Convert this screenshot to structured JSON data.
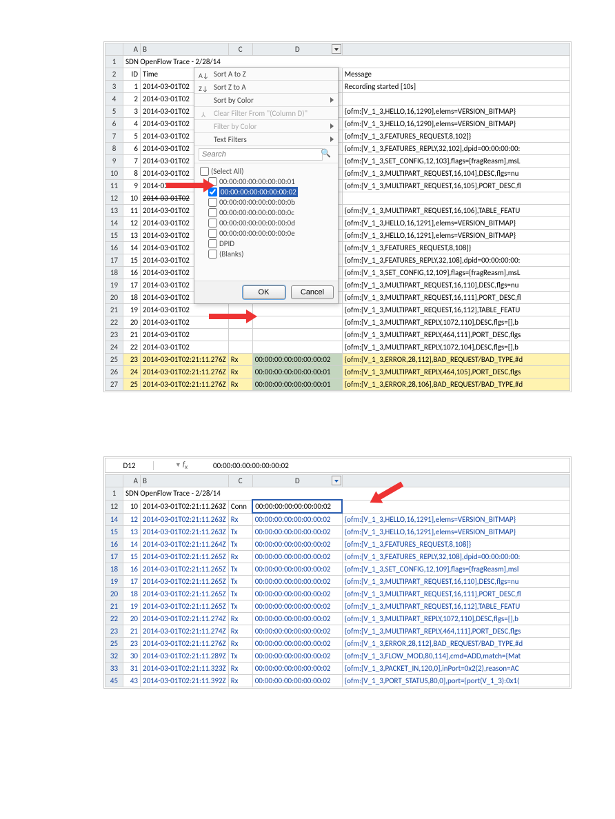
{
  "figure1": {
    "title": "SDN OpenFlow Trace - 2/28/14",
    "headers": {
      "A": "ID",
      "B": "Time",
      "E": "Message"
    },
    "menu": {
      "sort_az": "Sort A to Z",
      "sort_za": "Sort Z to A",
      "sort_color": "Sort by Color",
      "clear": "Clear Filter From \"(Column D)\"",
      "filter_color": "Filter by Color",
      "text_filters": "Text Filters",
      "search_ph": "Search",
      "select_all": "(Select All)",
      "items": [
        {
          "label": "00:00:00:00:00:00:00:01",
          "checked": false
        },
        {
          "label": "00:00:00:00:00:00:00:02",
          "checked": true,
          "highlight": true
        },
        {
          "label": "00:00:00:00:00:00:00:0b",
          "checked": false
        },
        {
          "label": "00:00:00:00:00:00:00:0c",
          "checked": false
        },
        {
          "label": "00:00:00:00:00:00:00:0d",
          "checked": false
        },
        {
          "label": "00:00:00:00:00:00:00:0e",
          "checked": false
        },
        {
          "label": "DPID",
          "checked": false
        },
        {
          "label": "(Blanks)",
          "checked": false
        }
      ],
      "ok": "OK",
      "cancel": "Cancel"
    },
    "rows": [
      {
        "n": 1,
        "title": true
      },
      {
        "n": 2,
        "A": "ID",
        "B": "Time",
        "E": "Message"
      },
      {
        "n": 3,
        "A": "1",
        "B": "2014-03-01T02",
        "E": "Recording started [10s]"
      },
      {
        "n": 4,
        "A": "2",
        "B": "2014-03-01T02"
      },
      {
        "n": 5,
        "A": "3",
        "B": "2014-03-01T02",
        "E": "{ofm:[V_1_3,HELLO,16,1290],elems=VERSION_BITMAP}"
      },
      {
        "n": 6,
        "A": "4",
        "B": "2014-03-01T02",
        "E": "{ofm:[V_1_3,HELLO,16,1290],elems=VERSION_BITMAP}"
      },
      {
        "n": 7,
        "A": "5",
        "B": "2014-03-01T02",
        "E": "{ofm:[V_1_3,FEATURES_REQUEST,8,102]}"
      },
      {
        "n": 8,
        "A": "6",
        "B": "2014-03-01T02",
        "E": "{ofm:[V_1_3,FEATURES_REPLY,32,102],dpid=00:00:00:00:"
      },
      {
        "n": 9,
        "A": "7",
        "B": "2014-03-01T02",
        "E": "{ofm:[V_1_3,SET_CONFIG,12,103],flags=[fragReasm],msL"
      },
      {
        "n": 10,
        "A": "8",
        "B": "2014-03-01T02",
        "E": "{ofm:[V_1_3,MULTIPART_REQUEST,16,104],DESC,flgs=nu"
      },
      {
        "n": 11,
        "A": "9",
        "B": "2014-03-01T02",
        "E": "{ofm:[V_1_3,MULTIPART_REQUEST,16,105],PORT_DESC,fl"
      },
      {
        "n": 12,
        "A": "10",
        "B": "2014-03-01T02",
        "sel": true
      },
      {
        "n": 13,
        "A": "11",
        "B": "2014-03-01T02",
        "E": "{ofm:[V_1_3,MULTIPART_REQUEST,16,106],TABLE_FEATU"
      },
      {
        "n": 14,
        "A": "12",
        "B": "2014-03-01T02",
        "E": "{ofm:[V_1_3,HELLO,16,1291],elems=VERSION_BITMAP}"
      },
      {
        "n": 15,
        "A": "13",
        "B": "2014-03-01T02",
        "E": "{ofm:[V_1_3,HELLO,16,1291],elems=VERSION_BITMAP}"
      },
      {
        "n": 16,
        "A": "14",
        "B": "2014-03-01T02",
        "E": "{ofm:[V_1_3,FEATURES_REQUEST,8,108]}"
      },
      {
        "n": 17,
        "A": "15",
        "B": "2014-03-01T02",
        "E": "{ofm:[V_1_3,FEATURES_REPLY,32,108],dpid=00:00:00:00:"
      },
      {
        "n": 18,
        "A": "16",
        "B": "2014-03-01T02",
        "E": "{ofm:[V_1_3,SET_CONFIG,12,109],flags=[fragReasm],msL"
      },
      {
        "n": 19,
        "A": "17",
        "B": "2014-03-01T02",
        "E": "{ofm:[V_1_3,MULTIPART_REQUEST,16,110],DESC,flgs=nu"
      },
      {
        "n": 20,
        "A": "18",
        "B": "2014-03-01T02",
        "E": "{ofm:[V_1_3,MULTIPART_REQUEST,16,111],PORT_DESC,fl"
      },
      {
        "n": 21,
        "A": "19",
        "B": "2014-03-01T02",
        "E": "{ofm:[V_1_3,MULTIPART_REQUEST,16,112],TABLE_FEATU"
      },
      {
        "n": 22,
        "A": "20",
        "B": "2014-03-01T02",
        "E": "{ofm:[V_1_3,MULTIPART_REPLY,1072,110],DESC,flgs=[],b"
      },
      {
        "n": 23,
        "A": "21",
        "B": "2014-03-01T02",
        "E": "{ofm:[V_1_3,MULTIPART_REPLY,464,111],PORT_DESC,flgs"
      },
      {
        "n": 24,
        "A": "22",
        "B": "2014-03-01T02",
        "E": "{ofm:[V_1_3,MULTIPART_REPLY,1072,104],DESC,flgs=[],b"
      },
      {
        "n": 25,
        "A": "23",
        "B": "2014-03-01T02:21:11.276Z",
        "C": "Rx",
        "D": "00:00:00:00:00:00:00:02",
        "E": "{ofm:[V_1_3,ERROR,28,112],BAD_REQUEST/BAD_TYPE,#d",
        "hl": true
      },
      {
        "n": 26,
        "A": "24",
        "B": "2014-03-01T02:21:11.276Z",
        "C": "Rx",
        "D": "00:00:00:00:00:00:00:01",
        "E": "{ofm:[V_1_3,MULTIPART_REPLY,464,105],PORT_DESC,flgs",
        "hl": true
      },
      {
        "n": 27,
        "A": "25",
        "B": "2014-03-01T02:21:11.276Z",
        "C": "Rx",
        "D": "00:00:00:00:00:00:00:01",
        "E": "{ofm:[V_1_3,ERROR,28,106],BAD_REQUEST/BAD_TYPE,#d",
        "hl": true
      }
    ]
  },
  "figure2": {
    "namebox": "D12",
    "formula_val": "00:00:00:00:00:00:00:02",
    "title": "SDN OpenFlow Trace - 2/28/14",
    "rows": [
      {
        "n": 1,
        "title": true
      },
      {
        "n": 12,
        "A": "10",
        "B": "2014-03-01T02:21:11.263Z",
        "C": "Conn",
        "D": "00:00:00:00:00:00:00:02",
        "selD": true
      },
      {
        "n": 14,
        "A": "12",
        "B": "2014-03-01T02:21:11.263Z",
        "C": "Rx",
        "D": "00:00:00:00:00:00:00:02",
        "E": "{ofm:[V_1_3,HELLO,16,1291],elems=VERSION_BITMAP}",
        "blue": true
      },
      {
        "n": 15,
        "A": "13",
        "B": "2014-03-01T02:21:11.263Z",
        "C": "Tx",
        "D": "00:00:00:00:00:00:00:02",
        "E": "{ofm:[V_1_3,HELLO,16,1291],elems=VERSION_BITMAP}",
        "blue": true
      },
      {
        "n": 16,
        "A": "14",
        "B": "2014-03-01T02:21:11.264Z",
        "C": "Tx",
        "D": "00:00:00:00:00:00:00:02",
        "E": "{ofm:[V_1_3,FEATURES_REQUEST,8,108]}",
        "blue": true
      },
      {
        "n": 17,
        "A": "15",
        "B": "2014-03-01T02:21:11.265Z",
        "C": "Rx",
        "D": "00:00:00:00:00:00:00:02",
        "E": "{ofm:[V_1_3,FEATURES_REPLY,32,108],dpid=00:00:00:00:",
        "blue": true
      },
      {
        "n": 18,
        "A": "16",
        "B": "2014-03-01T02:21:11.265Z",
        "C": "Tx",
        "D": "00:00:00:00:00:00:00:02",
        "E": "{ofm:[V_1_3,SET_CONFIG,12,109],flags=[fragReasm],msl",
        "blue": true
      },
      {
        "n": 19,
        "A": "17",
        "B": "2014-03-01T02:21:11.265Z",
        "C": "Tx",
        "D": "00:00:00:00:00:00:00:02",
        "E": "{ofm:[V_1_3,MULTIPART_REQUEST,16,110],DESC,flgs=nu",
        "blue": true
      },
      {
        "n": 20,
        "A": "18",
        "B": "2014-03-01T02:21:11.265Z",
        "C": "Tx",
        "D": "00:00:00:00:00:00:00:02",
        "E": "{ofm:[V_1_3,MULTIPART_REQUEST,16,111],PORT_DESC,fl",
        "blue": true
      },
      {
        "n": 21,
        "A": "19",
        "B": "2014-03-01T02:21:11.265Z",
        "C": "Tx",
        "D": "00:00:00:00:00:00:00:02",
        "E": "{ofm:[V_1_3,MULTIPART_REQUEST,16,112],TABLE_FEATU",
        "blue": true
      },
      {
        "n": 22,
        "A": "20",
        "B": "2014-03-01T02:21:11.274Z",
        "C": "Rx",
        "D": "00:00:00:00:00:00:00:02",
        "E": "{ofm:[V_1_3,MULTIPART_REPLY,1072,110],DESC,flgs=[],b",
        "blue": true
      },
      {
        "n": 23,
        "A": "21",
        "B": "2014-03-01T02:21:11.274Z",
        "C": "Rx",
        "D": "00:00:00:00:00:00:00:02",
        "E": "{ofm:[V_1_3,MULTIPART_REPLY,464,111],PORT_DESC,flgs",
        "blue": true
      },
      {
        "n": 25,
        "A": "23",
        "B": "2014-03-01T02:21:11.276Z",
        "C": "Rx",
        "D": "00:00:00:00:00:00:00:02",
        "E": "{ofm:[V_1_3,ERROR,28,112],BAD_REQUEST/BAD_TYPE,#d",
        "blue": true
      },
      {
        "n": 32,
        "A": "30",
        "B": "2014-03-01T02:21:11.289Z",
        "C": "Tx",
        "D": "00:00:00:00:00:00:00:02",
        "E": "{ofm:[V_1_3,FLOW_MOD,80,114],cmd=ADD,match={Mat",
        "blue": true
      },
      {
        "n": 33,
        "A": "31",
        "B": "2014-03-01T02:21:11.323Z",
        "C": "Rx",
        "D": "00:00:00:00:00:00:00:02",
        "E": "{ofm:[V_1_3,PACKET_IN,120,0],inPort=0x2(2),reason=AC",
        "blue": true
      },
      {
        "n": 45,
        "A": "43",
        "B": "2014-03-01T02:21:11.392Z",
        "C": "Rx",
        "D": "00:00:00:00:00:00:00:02",
        "E": "{ofm:[V_1_3,PORT_STATUS,80,0],port={port(V_1_3):0x1(",
        "blue": true
      }
    ]
  }
}
